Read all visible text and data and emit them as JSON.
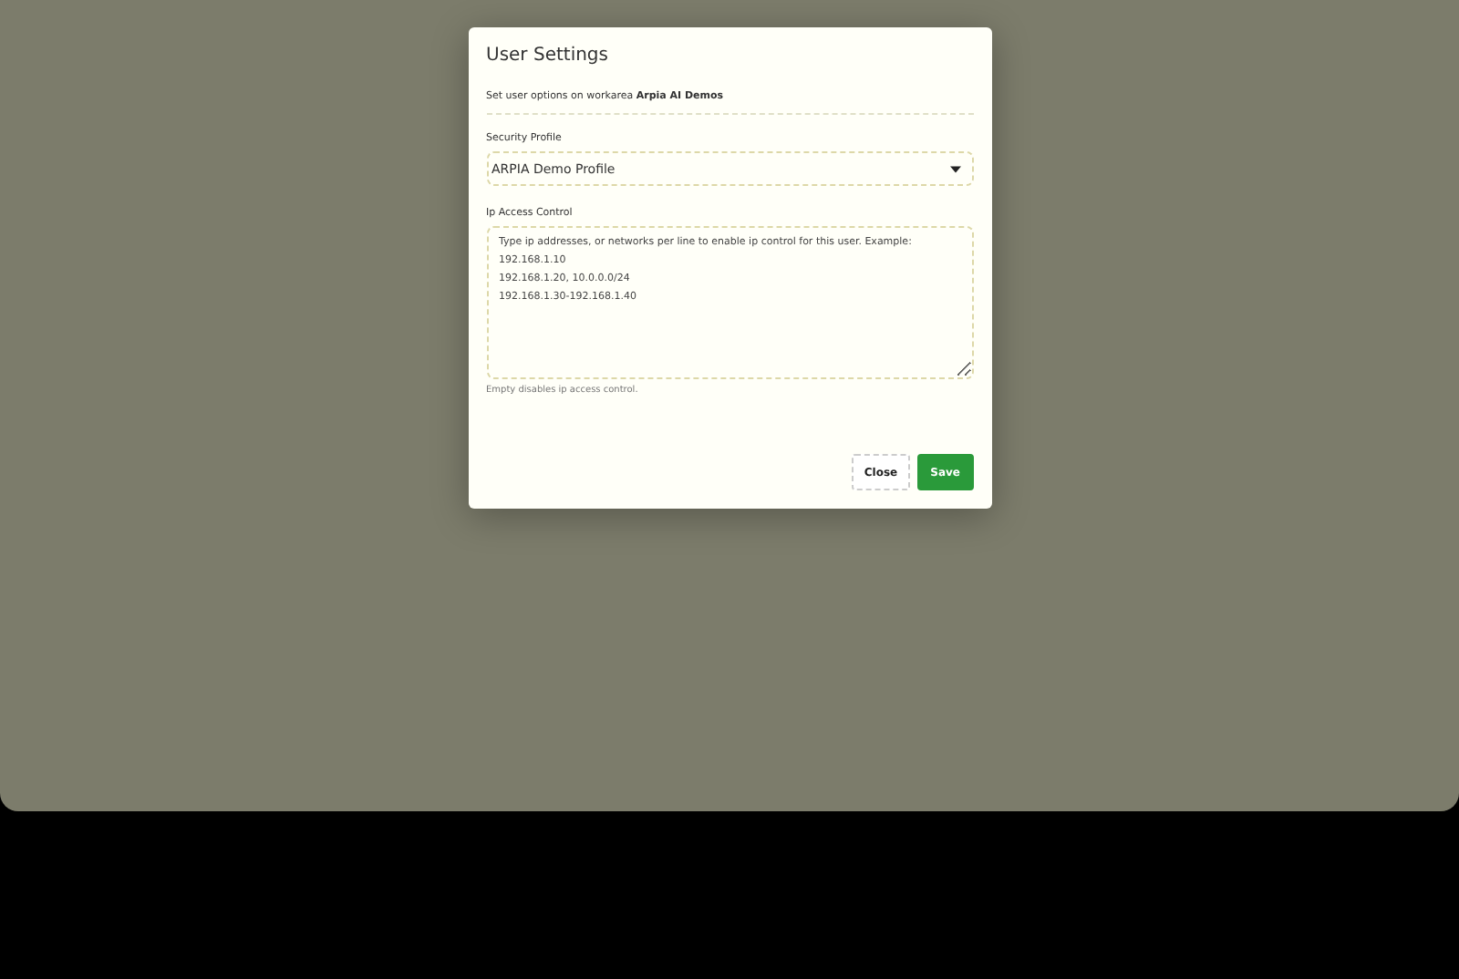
{
  "dialog": {
    "title": "User Settings",
    "intro": "Set user options on workarea **Arpia AI Demos**",
    "security_profile": {
      "label": "Security Profile",
      "value": "ARPIA Demo Profile"
    },
    "ip_access": {
      "label": "Ip Access Control",
      "placeholder": "Type ip addresses, or networks per line to enable ip control for this user. Example:\n192.168.1.10\n192.168.1.20, 10.0.0.0/24\n192.168.1.30-192.168.1.40",
      "hint": "Empty disables ip access control."
    },
    "buttons": [
      {
        "label": "Close",
        "kind": "secondary"
      },
      {
        "label": "Save",
        "kind": "primary"
      }
    ]
  }
}
